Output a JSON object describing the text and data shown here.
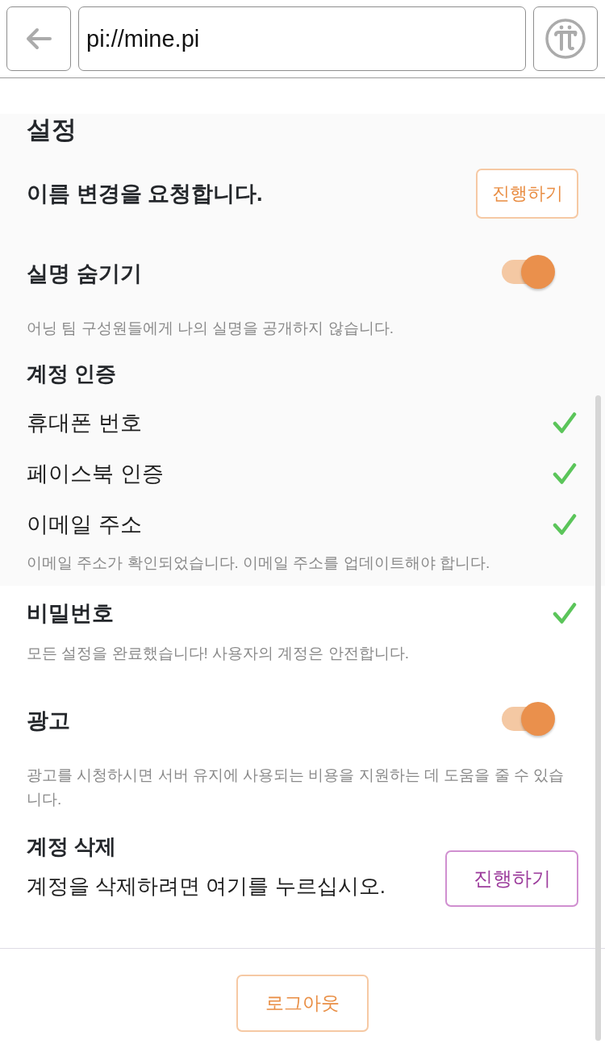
{
  "toolbar": {
    "url": "pi://mine.pi"
  },
  "panels": [
    {
      "shaded": true,
      "heading": "설정",
      "sections": [
        {
          "kind": "action",
          "label": "이름 변경을 요청합니다.",
          "button": "진행하기"
        },
        {
          "kind": "toggle",
          "label": "실명 숨기기",
          "on": true,
          "note": "어닝 팀 구성원들에게 나의 실명을 공개하지 않습니다."
        },
        {
          "kind": "checklist",
          "label": "계정 인증",
          "items": [
            {
              "label": "휴대폰 번호",
              "checked": true
            },
            {
              "label": "페이스북 인증",
              "checked": true
            },
            {
              "label": "이메일 주소",
              "checked": true
            }
          ],
          "note": "이메일 주소가 확인되었습니다. 이메일 주소를 업데이트해야 합니다."
        }
      ]
    },
    {
      "shaded": false,
      "sections": [
        {
          "kind": "status",
          "label": "비밀번호",
          "checked": true,
          "note": "모든 설정을 완료했습니다! 사용자의 계정은 안전합니다."
        },
        {
          "kind": "toggle",
          "label": "광고",
          "on": true,
          "note": "광고를 시청하시면 서버 유지에 사용되는 비용을 지원하는 데 도움을 줄 수 있습니다."
        },
        {
          "kind": "danger",
          "label": "계정 삭제",
          "text": "계정을 삭제하려면 여기를 누르십시오.",
          "button": "진행하기"
        }
      ]
    }
  ],
  "footer": {
    "logout": "로그아웃"
  }
}
